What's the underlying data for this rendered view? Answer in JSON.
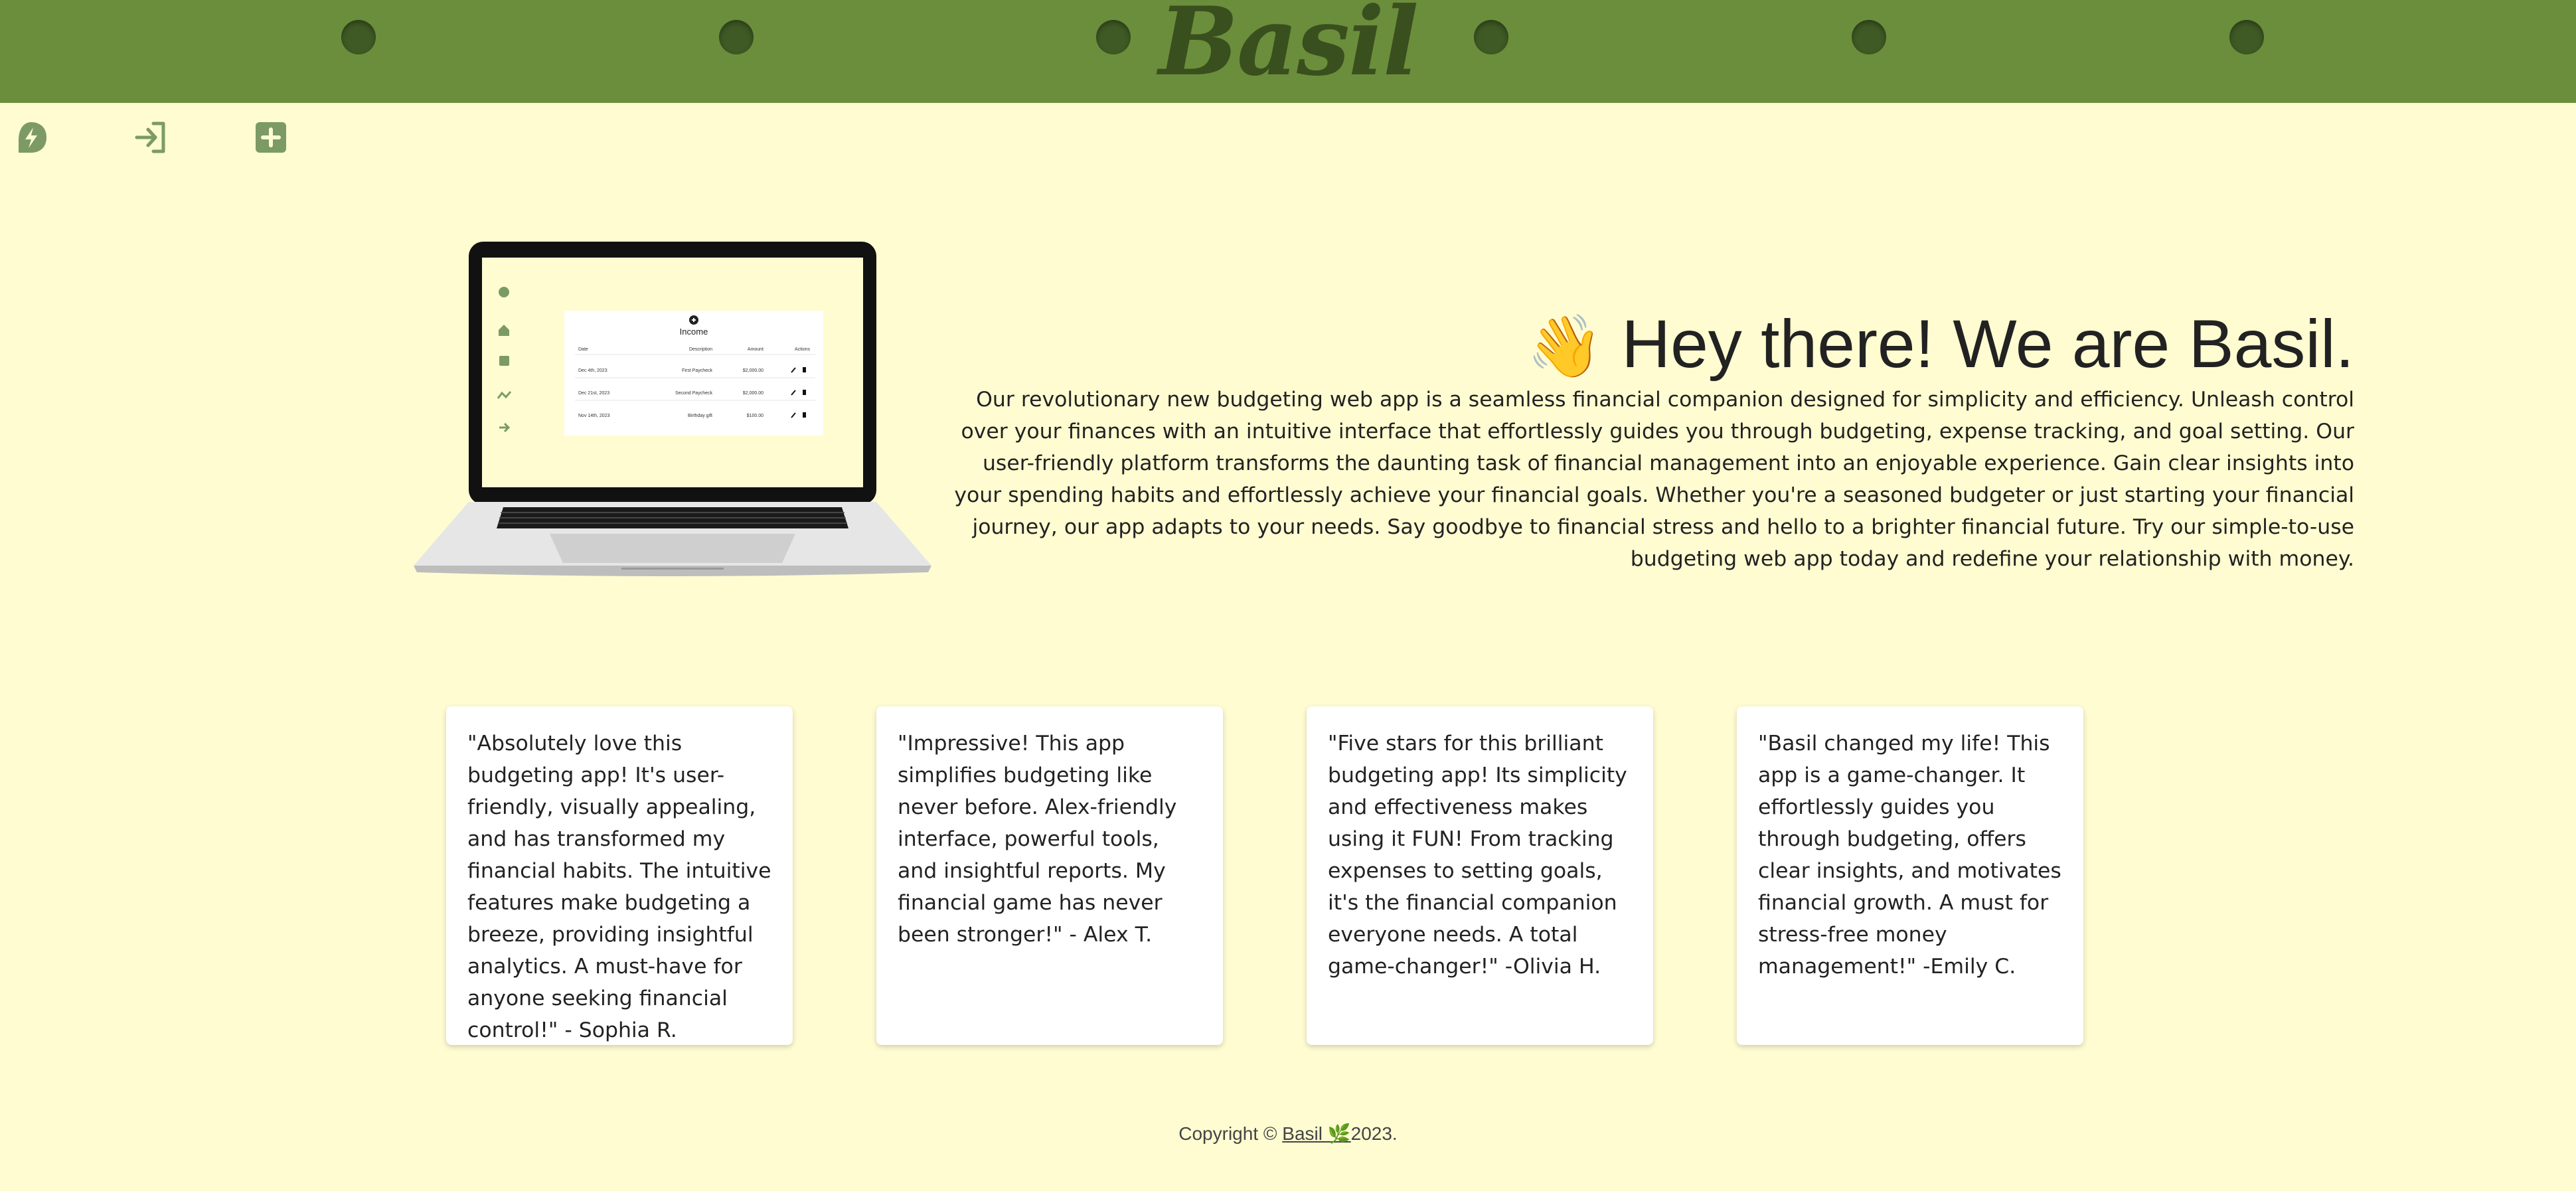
{
  "brand": {
    "name": "Basil",
    "header_color": "#6b8e3c",
    "background": "#fffcd1"
  },
  "toolbar": {
    "icons": [
      "leaf-bolt-icon",
      "login-icon",
      "add-square-icon"
    ]
  },
  "hero": {
    "wave_emoji": "👋",
    "title": "Hey there! We are Basil.",
    "body": "Our revolutionary new budgeting web app is a seamless financial companion designed for simplicity and efficiency. Unleash control over your finances with an intuitive interface that effortlessly guides you through budgeting, expense tracking, and goal setting. Our user-friendly platform transforms the daunting task of financial management into an enjoyable experience. Gain clear insights into your spending habits and effortlessly achieve your financial goals. Whether you're a seasoned budgeter or just starting your financial journey, our app adapts to your needs. Say goodbye to financial stress and hello to a brighter financial future. Try our simple-to-use budgeting web app today and redefine your relationship with money."
  },
  "laptop_screen": {
    "panel_title": "Income",
    "columns": [
      "Date",
      "Description",
      "Amount",
      "Actions"
    ],
    "rows": [
      {
        "date": "Dec 4th, 2023",
        "description": "First Paycheck",
        "amount": "$2,000.00"
      },
      {
        "date": "Dec 21st, 2023",
        "description": "Second Paycheck",
        "amount": "$2,000.00"
      },
      {
        "date": "Nov 14th, 2023",
        "description": "Birthday gift",
        "amount": "$100.00"
      }
    ]
  },
  "testimonials": [
    {
      "text": "\"Absolutely love this budgeting app! It's user-friendly, visually appealing, and has transformed my financial habits. The intuitive features make budgeting a breeze, providing insightful analytics. A must-have for anyone seeking financial control!\" - Sophia R."
    },
    {
      "text": "\"Impressive! This app simplifies budgeting like never before. Alex-friendly interface, powerful tools, and insightful reports. My financial game has never been stronger!\" - Alex T."
    },
    {
      "text": "\"Five stars for this brilliant budgeting app! Its simplicity and effectiveness makes using it FUN! From tracking expenses to setting goals, it's the financial companion everyone needs. A total game-changer!\" -Olivia H."
    },
    {
      "text": "\"Basil changed my life! This app is a game-changer. It effortlessly guides you through budgeting, offers clear insights, and motivates financial growth. A must for stress-free money management!\" -Emily C."
    }
  ],
  "footer": {
    "prefix": "Copyright © ",
    "link_text": "Basil 🌿",
    "suffix": "2023."
  }
}
